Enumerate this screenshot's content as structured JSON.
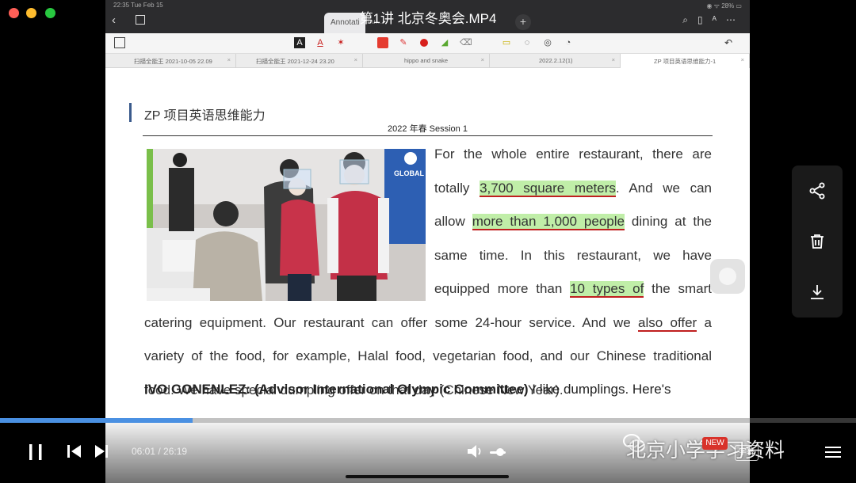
{
  "window": {
    "title": "第1讲 北京冬奥会.MP4"
  },
  "status": {
    "time": "22:35  Tue Feb 15",
    "battery": "◉ ᯤ 28% ▭"
  },
  "app_nav": {
    "doc_tab": "Annotati",
    "ghost_tab": "Fu…"
  },
  "tabs": [
    "扫描全能王 2021-10-05 22.09",
    "扫描全能王 2021-12-24 23.20",
    "hippo and snake",
    "2022.2.12(1)",
    "ZP 项目英语思维能力-1"
  ],
  "page": {
    "heading": "ZP 项目英语思维能力",
    "session": "2022 年春  Session 1",
    "lines": {
      "l1": "For the whole entire restaurant, there are",
      "l2_a": "totally ",
      "l2_hl": "3,700 square meters",
      "l2_b": ". And we can",
      "l3_a": "allow ",
      "l3_hl": "more than 1,000 people",
      "l3_b": " dining at the",
      "l4": "same time. In this restaurant, we have",
      "l5_a": "equipped more than ",
      "l5_hl": "10 types of",
      "l5_b": " the smart",
      "l6_a": "catering equipment. Our restaurant can offer some 24-hour service. And we ",
      "l6_ul": "also offer",
      "l6_b": " a",
      "l7": "variety of the food, for example, Halal food, vegetarian food, and our Chinese traditional",
      "l8": "food. We have special dumpling offer on that day (Chinese New Year)."
    },
    "interview_speaker": "IVO GONENLEZ: (Advisor International Olympic Committee)",
    "interview_text": " I like dumplings. Here's"
  },
  "photo": {
    "badge": "GLOBAL"
  },
  "player": {
    "elapsed": "06:01",
    "total": "26:19",
    "progress_fraction": 0.225,
    "watermark": "北京小学学习资料",
    "badge": "NEW",
    "subtitle_label": "字幕",
    "accent_color": "#4a90e2"
  }
}
